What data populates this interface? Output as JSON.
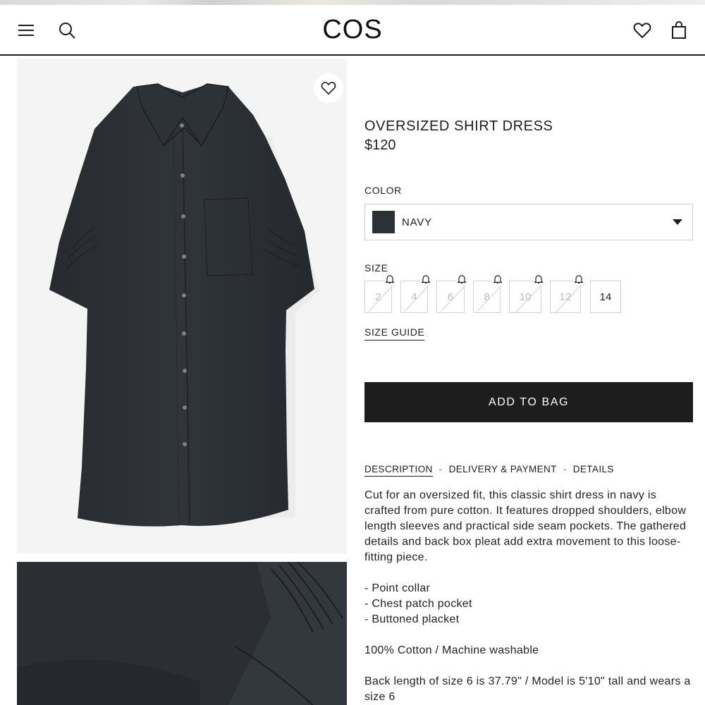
{
  "header": {
    "logo": "COS",
    "icons": {
      "menu": "menu-icon",
      "search": "search-icon",
      "wishlist": "heart-icon",
      "bag": "bag-icon"
    }
  },
  "product": {
    "title": "OVERSIZED SHIRT DRESS",
    "price": "$120",
    "color_label": "COLOR",
    "color_value": "NAVY",
    "color_swatch": "#2c3136",
    "size_label": "SIZE",
    "sizes": [
      {
        "label": "2",
        "available": false
      },
      {
        "label": "4",
        "available": false
      },
      {
        "label": "6",
        "available": false
      },
      {
        "label": "8",
        "available": false
      },
      {
        "label": "10",
        "available": false
      },
      {
        "label": "12",
        "available": false
      },
      {
        "label": "14",
        "available": true
      }
    ],
    "size_guide": "SIZE GUIDE",
    "add_to_bag": "ADD TO BAG"
  },
  "tabs": [
    {
      "label": "DESCRIPTION",
      "active": true
    },
    {
      "label": "DELIVERY & PAYMENT",
      "active": false
    },
    {
      "label": "DETAILS",
      "active": false
    }
  ],
  "tab_separator": "-",
  "description": {
    "paragraph": "Cut for an oversized fit, this classic shirt dress in navy is crafted from pure cotton. It features dropped shoulders, elbow length sleeves and practical side seam pockets. The gathered details and back box pleat add extra movement to this loose-fitting piece.",
    "bullets": [
      "- Point collar",
      "- Chest patch pocket",
      "- Buttoned placket"
    ],
    "composition": "100% Cotton / Machine washable",
    "fit_note": "Back length of size 6 is 37.79\" / Model is 5'10\" tall and wears a size 6"
  },
  "colors": {
    "text": "#1d1d1d",
    "button_bg": "#1d1d1d",
    "garment": "#2a2e32",
    "image_bg": "#f4f4f4"
  }
}
